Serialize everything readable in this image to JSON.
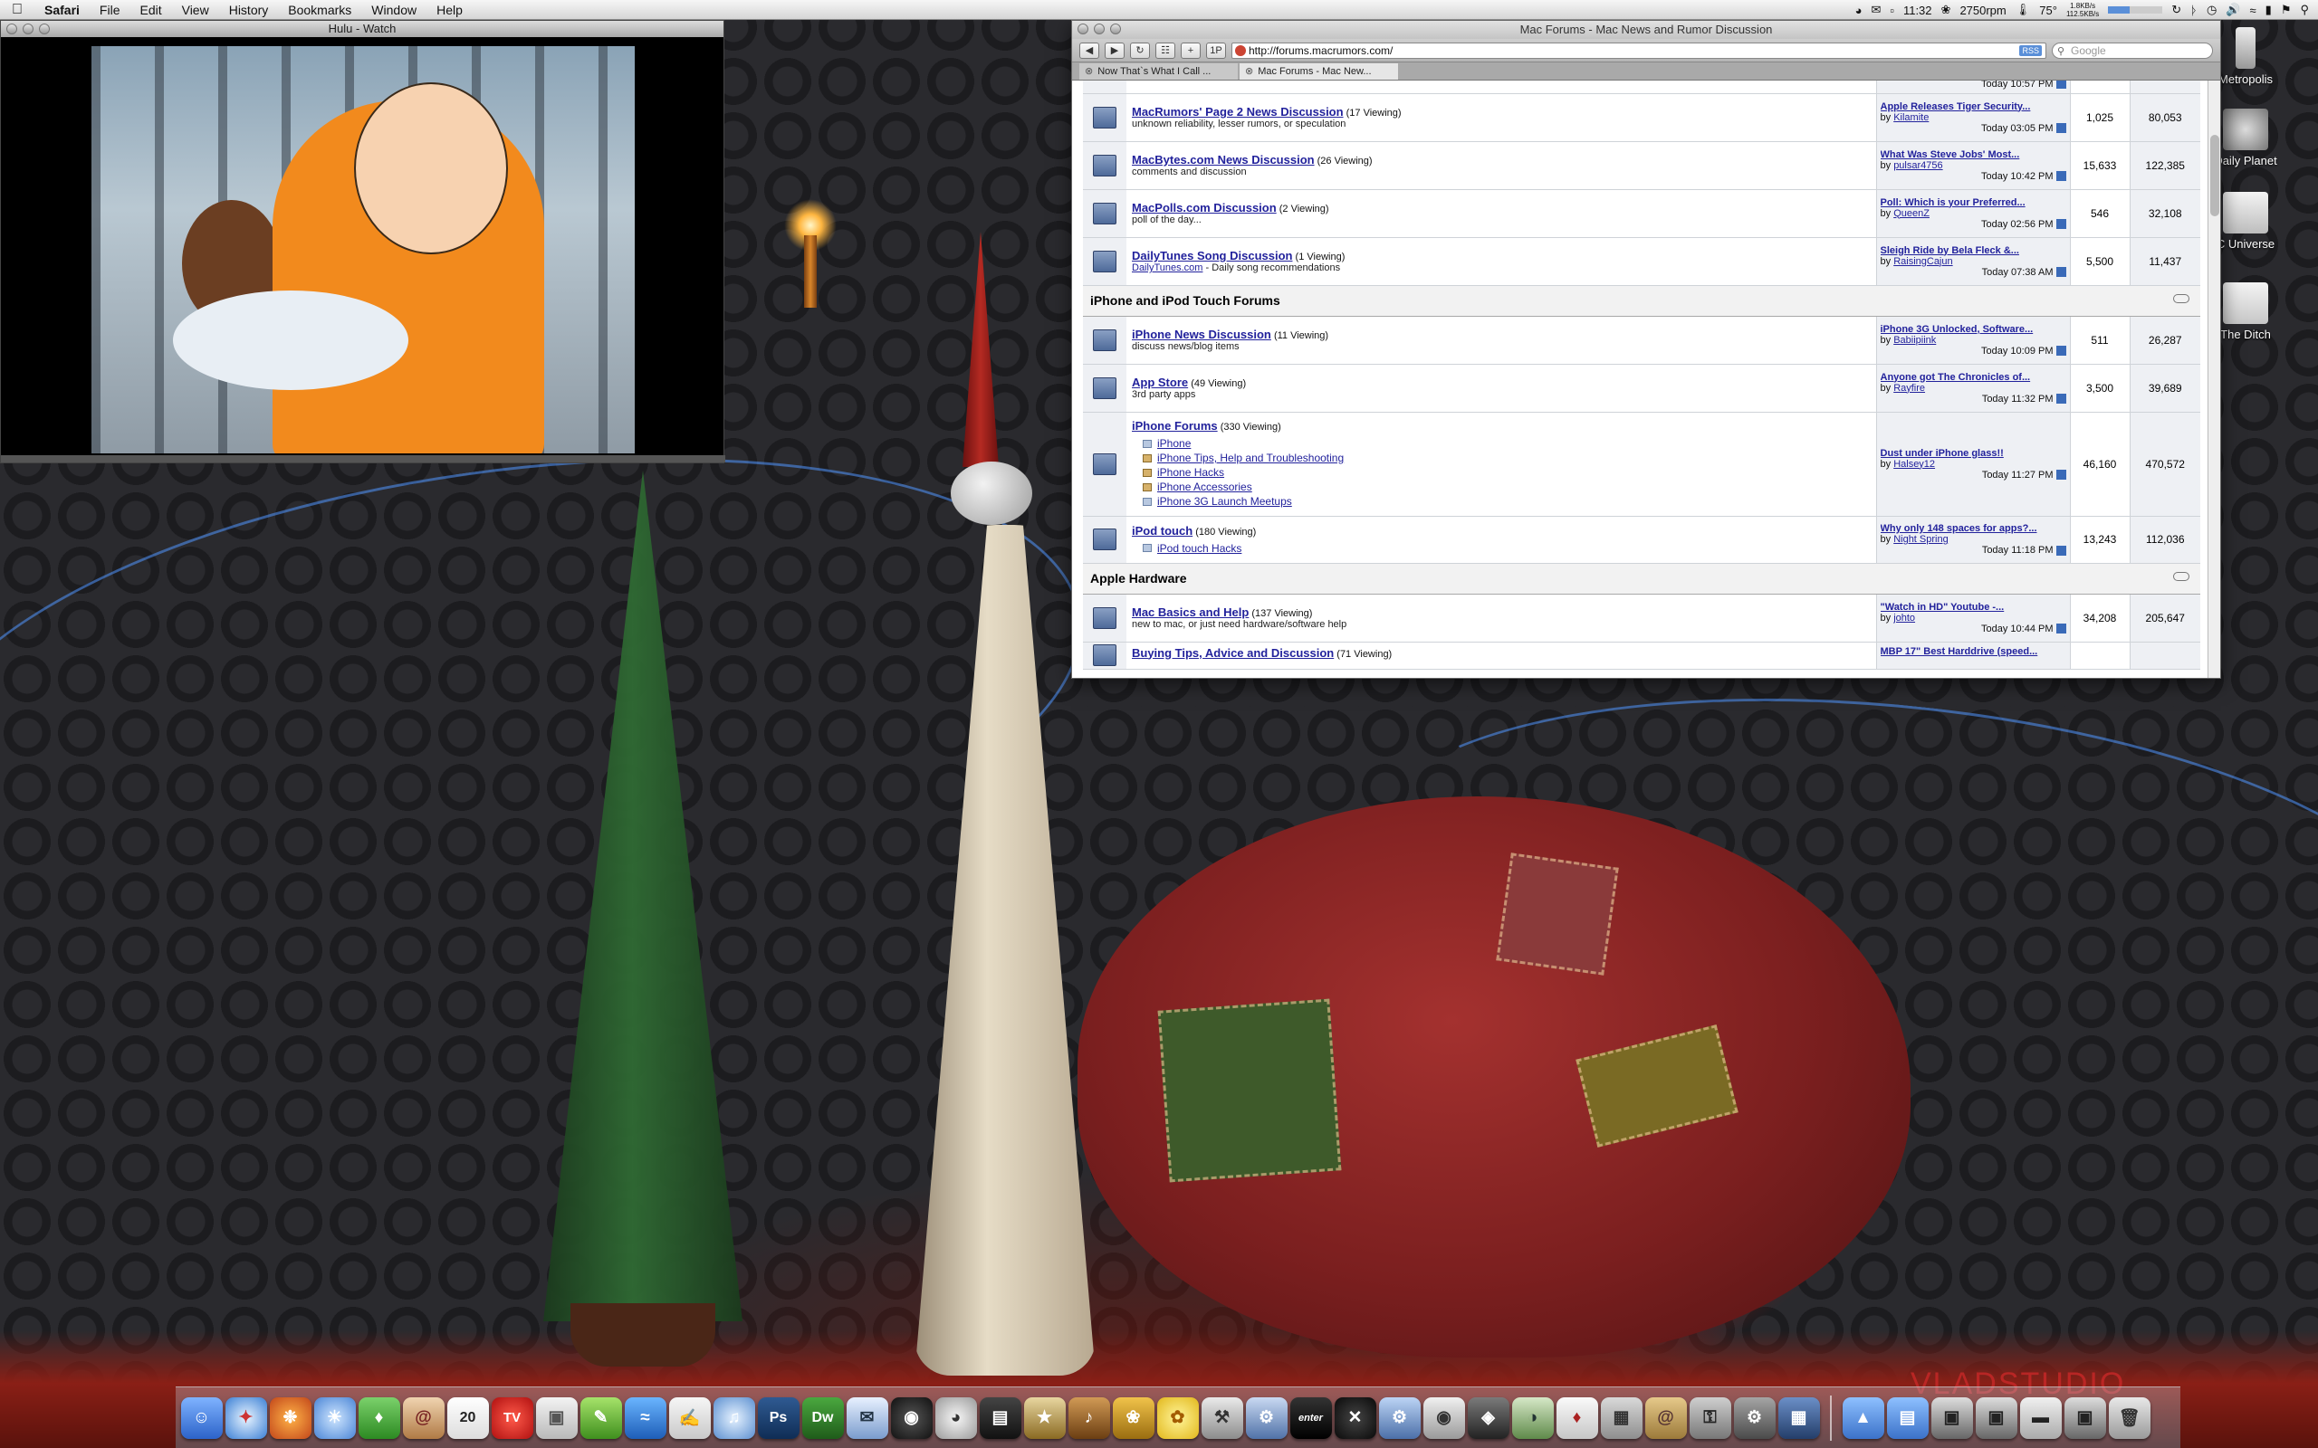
{
  "menubar": {
    "app_name": "Safari",
    "items": [
      "File",
      "Edit",
      "View",
      "History",
      "Bookmarks",
      "Window",
      "Help"
    ],
    "clock": "11:32",
    "fan": "2750rpm",
    "temp": "75°",
    "net_up": "1.8KB/s",
    "net_down": "112.5KB/s"
  },
  "hulu": {
    "title": "Hulu - Watch"
  },
  "safari": {
    "title": "Mac Forums - Mac News and Rumor Discussion",
    "url": "http://forums.macrumors.com/",
    "rss": "RSS",
    "search_placeholder": "Google",
    "tabs": [
      {
        "label": "Now That`s What I Call ...",
        "active": false
      },
      {
        "label": "Mac Forums - Mac New...",
        "active": true
      }
    ],
    "top_partial_time": "Today 10:57 PM",
    "forums_a": [
      {
        "name": "MacRumors' Page 2 News Discussion",
        "viewing": "(17 Viewing)",
        "desc": "unknown reliability, lesser rumors, or speculation",
        "desc_link": "",
        "lp_title": "Apple Releases Tiger Security...",
        "lp_by": "by",
        "lp_user": "Kilamite",
        "lp_time": "Today 03:05 PM",
        "threads": "1,025",
        "posts": "80,053"
      },
      {
        "name": "MacBytes.com News Discussion",
        "viewing": "(26 Viewing)",
        "desc": "comments and discussion",
        "desc_link": "",
        "lp_title": "What Was Steve Jobs' Most...",
        "lp_by": "by",
        "lp_user": "pulsar4756",
        "lp_time": "Today 10:42 PM",
        "threads": "15,633",
        "posts": "122,385"
      },
      {
        "name": "MacPolls.com Discussion",
        "viewing": "(2 Viewing)",
        "desc": "poll of the day...",
        "desc_link": "",
        "lp_title": "Poll: Which is your Preferred...",
        "lp_by": "by",
        "lp_user": "QueenZ",
        "lp_time": "Today 02:56 PM",
        "threads": "546",
        "posts": "32,108"
      },
      {
        "name": "DailyTunes Song Discussion",
        "viewing": "(1 Viewing)",
        "desc": " - Daily song recommendations",
        "desc_link": "DailyTunes.com",
        "lp_title": "Sleigh Ride by Bela Fleck &...",
        "lp_by": "by",
        "lp_user": "RaisingCajun",
        "lp_time": "Today 07:38 AM",
        "threads": "5,500",
        "posts": "11,437"
      }
    ],
    "cat_iphone": "iPhone and iPod Touch Forums",
    "forums_b": [
      {
        "name": "iPhone News Discussion",
        "viewing": "(11 Viewing)",
        "desc": "discuss news/blog items",
        "lp_title": "iPhone 3G Unlocked, Software...",
        "lp_by": "by",
        "lp_user": "Babiipiink",
        "lp_time": "Today 10:09 PM",
        "threads": "511",
        "posts": "26,287"
      },
      {
        "name": "App Store",
        "viewing": "(49 Viewing)",
        "desc": "3rd party apps",
        "lp_title": "Anyone got The Chronicles of...",
        "lp_by": "by",
        "lp_user": "Rayfire",
        "lp_time": "Today 11:32 PM",
        "threads": "3,500",
        "posts": "39,689"
      }
    ],
    "iphone_forums": {
      "name": "iPhone Forums",
      "viewing": "(330 Viewing)",
      "subs": [
        "iPhone",
        "iPhone Tips, Help and Troubleshooting",
        "iPhone Hacks",
        "iPhone Accessories",
        "iPhone 3G Launch Meetups"
      ],
      "lp_title": "Dust under iPhone glass!!",
      "lp_by": "by",
      "lp_user": "Halsey12",
      "lp_time": "Today 11:27 PM",
      "threads": "46,160",
      "posts": "470,572"
    },
    "ipod_touch": {
      "name": "iPod touch",
      "viewing": "(180 Viewing)",
      "sub": "iPod touch Hacks",
      "lp_title": "Why only 148 spaces for apps?...",
      "lp_by": "by",
      "lp_user": "Night Spring",
      "lp_time": "Today 11:18 PM",
      "threads": "13,243",
      "posts": "112,036"
    },
    "cat_hardware": "Apple Hardware",
    "mac_basics": {
      "name": "Mac Basics and Help",
      "viewing": "(137 Viewing)",
      "desc": "new to mac, or just need hardware/software help",
      "lp_title": "\"Watch in HD\" Youtube -...",
      "lp_by": "by",
      "lp_user": "johto",
      "lp_time": "Today 10:44 PM",
      "threads": "34,208",
      "posts": "205,647"
    },
    "buying_tips": {
      "name": "Buying Tips, Advice and Discussion",
      "viewing": "(71 Viewing)",
      "lp_title": "MBP 17\" Best Harddrive (speed..."
    }
  },
  "desktop_icons": [
    "Metropolis",
    "Daily Planet",
    "C Universe",
    "The Ditch"
  ],
  "dock_icons": [
    "finder-icon",
    "safari-icon",
    "firefox-icon",
    "ichat-icon",
    "adium-icon",
    "address-book-icon",
    "ical-icon",
    "tv-icon",
    "preview-icon",
    "itunes-icon",
    "photoshop-icon",
    "dreamweaver-icon",
    "mail-icon",
    "dvd-icon",
    "istat-icon",
    "activity-icon",
    "iphoto-icon",
    "garageband-icon",
    "pineapple-icon",
    "cyberduck-icon",
    "textedit-icon",
    "script-icon",
    "terminal-icon",
    "x11-icon",
    "system-prefs-icon",
    "camera-icon",
    "photobooth-icon",
    "network-icon",
    "calculator-icon",
    "stickies-icon",
    "keychain-icon",
    "screenshot-icon",
    "spaces-icon"
  ],
  "dock_labels": {
    "ical_day": "20",
    "tv": "TV",
    "ps": "Ps",
    "dw": "Dw",
    "enter": "enter"
  },
  "watermark": "VLADSTUDIO",
  "colors": {
    "link": "#22229c",
    "row_alt": "#eef0f4",
    "category_bg": "#f2f2f2"
  }
}
